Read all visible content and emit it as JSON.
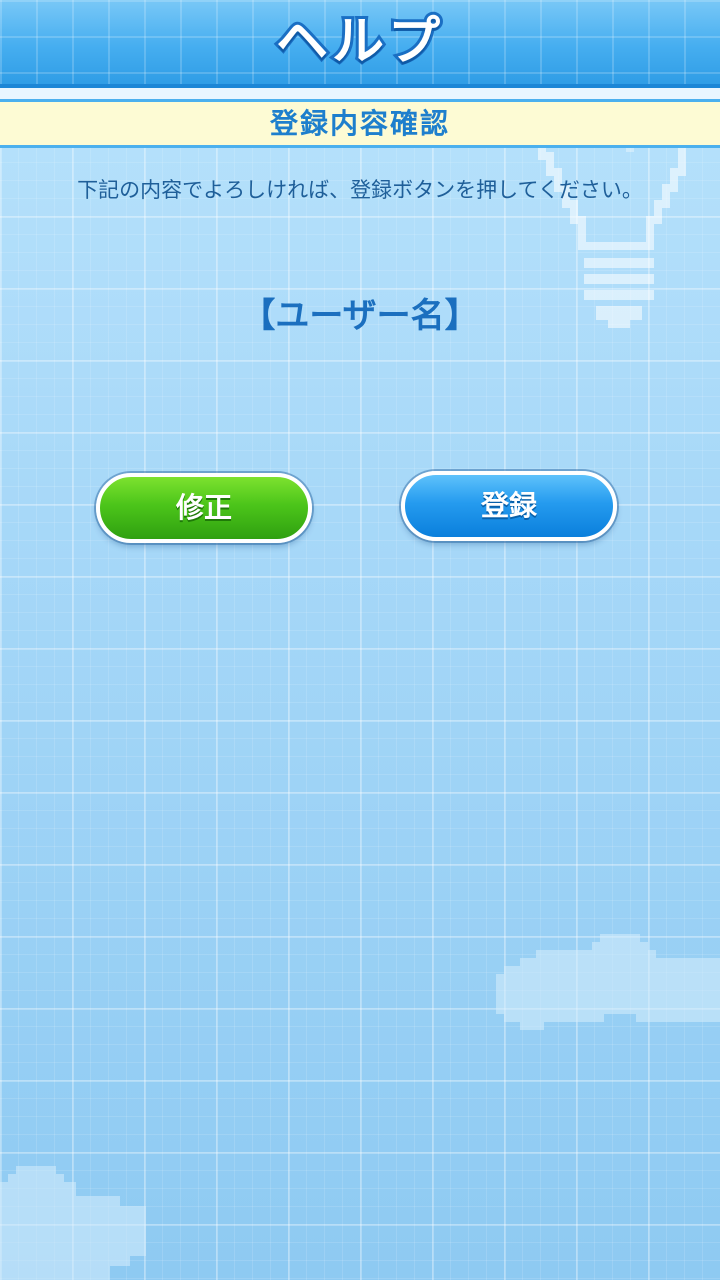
{
  "header": {
    "title": "ヘルプ"
  },
  "section": {
    "title": "登録内容確認"
  },
  "instruction": {
    "text": "下記の内容でよろしければ、登録ボタンを押してください。"
  },
  "username": {
    "text": "【ユーザー名】"
  },
  "buttons": {
    "fix_label": "修正",
    "register_label": "登録"
  },
  "colors": {
    "header_blue": "#3aa8ee",
    "banner_yellow": "#fdfbd4",
    "text_blue": "#1e7fcd",
    "fix_green": "#4cc51a",
    "register_blue": "#259bef",
    "background": "#a7d8f8"
  },
  "decorations": {
    "bulb": "light-bulb-icon",
    "clouds": "cloud-icon"
  }
}
